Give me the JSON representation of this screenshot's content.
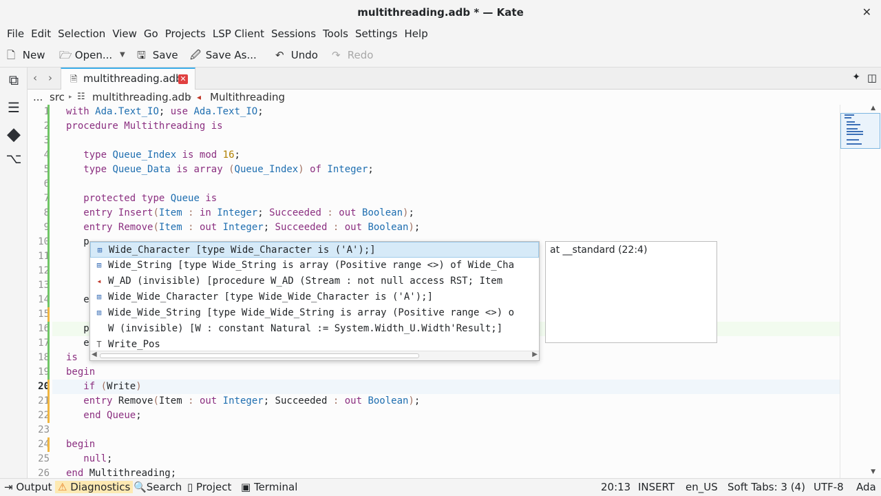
{
  "window": {
    "title": "multithreading.adb * — Kate"
  },
  "menu": [
    "File",
    "Edit",
    "Selection",
    "View",
    "Go",
    "Projects",
    "LSP Client",
    "Sessions",
    "Tools",
    "Settings",
    "Help"
  ],
  "toolbar": {
    "new": "New",
    "open": "Open...",
    "save": "Save",
    "save_as": "Save As...",
    "undo": "Undo",
    "redo": "Redo"
  },
  "tab": {
    "label": "multithreading.adb"
  },
  "breadcrumb": {
    "ellipsis": "...",
    "dir": "src",
    "file": "multithreading.adb",
    "symbol": "Multithreading"
  },
  "line_numbers": [
    "1",
    "2",
    "3",
    "4",
    "5",
    "6",
    "7",
    "8",
    "9",
    "10",
    "11",
    "12",
    "13",
    "14",
    "15",
    "16",
    "17",
    "18",
    "19",
    "20",
    "21",
    "22",
    "23",
    "24",
    "25",
    "26"
  ],
  "current_line": "20",
  "code_lines": {
    "l1": "with Ada.Text_IO; use Ada.Text_IO;",
    "l2": "procedure Multithreading is",
    "l4": "   type Queue_Index is mod 16;",
    "l5": "   type Queue_Data is array (Queue_Index) of Integer;",
    "l7": "   protected type Queue is",
    "l8": "   entry Insert(Item : in Integer; Succeeded : out Boolean);",
    "l9": "   entry Remove(Item : out Integer; Succeeded : out Boolean);",
    "l10": "   p",
    "l14": "   e",
    "l16": "   p",
    "l17": "   e",
    "l18": "is",
    "l19": "begin",
    "l20": "   if (Write)",
    "l21": "   entry Remove(Item : out Integer; Succeeded : out Boolean);",
    "l22": "   end Queue;",
    "l24": "begin",
    "l25": "   null;",
    "l26": "end Multithreading;"
  },
  "completion": {
    "items": [
      {
        "icon": "type-icon",
        "text": "Wide_Character [type Wide_Character is ('A');]"
      },
      {
        "icon": "type-icon",
        "text": "Wide_String [type Wide_String is array (Positive range <>) of Wide_Cha"
      },
      {
        "icon": "procedure-icon",
        "text": "W_AD (invisible) [procedure W_AD (Stream : not null access RST; Item"
      },
      {
        "icon": "type-icon",
        "text": "Wide_Wide_Character [type Wide_Wide_Character is ('A');]"
      },
      {
        "icon": "type-icon",
        "text": "Wide_Wide_String [type Wide_Wide_String is array (Positive range <>) o"
      },
      {
        "icon": "none",
        "text": "W (invisible) [W : constant Natural := System.Width_U.Width'Result;]"
      },
      {
        "icon": "snippet-icon",
        "text": "Write_Pos"
      }
    ],
    "doc": "at __standard (22:4)"
  },
  "statusbar": {
    "output": "Output",
    "diagnostics": "Diagnostics",
    "search": "Search",
    "project": "Project",
    "terminal": "Terminal",
    "cursor": "20:13",
    "mode": "INSERT",
    "dictionary": "en_US",
    "indent": "Soft Tabs: 3 (4)",
    "encoding": "UTF-8",
    "language": "Ada"
  },
  "colors": {
    "accent": "#3daee9",
    "keyword": "#8b2f80",
    "type": "#1e6eb0",
    "number": "#b08000",
    "modified": "#6fc565",
    "saved_modified": "#f0b540"
  }
}
